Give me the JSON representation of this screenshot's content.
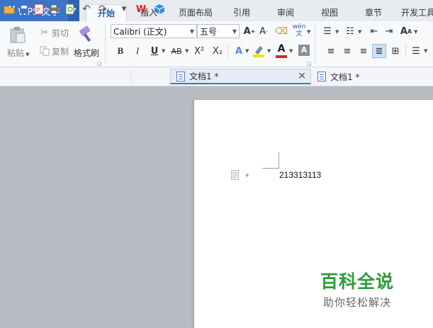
{
  "app": {
    "logo": "W",
    "name": "WPS 文字",
    "menu_arrow": "▼"
  },
  "tabs": [
    {
      "label": "开始",
      "active": true
    },
    {
      "label": "插入"
    },
    {
      "label": "页面布局"
    },
    {
      "label": "引用"
    },
    {
      "label": "审阅"
    },
    {
      "label": "视图"
    },
    {
      "label": "章节"
    },
    {
      "label": "开发工具"
    }
  ],
  "ribbon": {
    "paste_label": "粘贴",
    "cut_label": "剪切",
    "copy_label": "复制",
    "format_painter_label": "格式刷",
    "font_name": "Calibri (正文)",
    "font_size": "五号",
    "bold": "B",
    "italic": "I",
    "underline": "U",
    "strikethrough": "AB",
    "superscript": "X²",
    "subscript": "X₂",
    "font_color_letter": "A",
    "wen_label": "wén 文",
    "highlight_color": "#f4e100",
    "font_color": "#d9261c"
  },
  "document_tabs": [
    {
      "label": "文档1 *",
      "active": true,
      "close": "×"
    },
    {
      "label": "文档1 *",
      "active": false
    }
  ],
  "document": {
    "content": "213313113"
  },
  "watermark": {
    "title": "百科全说",
    "subtitle": "助你轻松解决"
  },
  "colors": {
    "accent": "#3b74c9",
    "workspace": "#b9bcc2",
    "watermark_green": "#2e9b3a"
  }
}
